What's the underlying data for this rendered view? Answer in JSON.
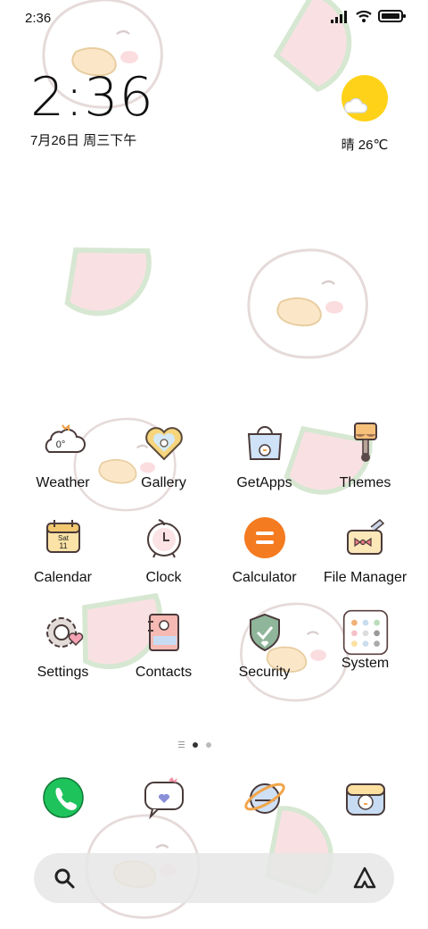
{
  "status_bar": {
    "time": "2:36",
    "icons": [
      "signal-icon",
      "wifi-icon",
      "battery-icon"
    ]
  },
  "clock_widget": {
    "time": "2:36",
    "date": "7月26日 周三下午"
  },
  "weather_widget": {
    "icon": "sun-cloud-icon",
    "text": "晴 26℃"
  },
  "apps": [
    {
      "label": "Weather",
      "icon": "weather-cloud-icon",
      "badge": "0°"
    },
    {
      "label": "Gallery",
      "icon": "heart-frame-icon"
    },
    {
      "label": "GetApps",
      "icon": "shopping-bag-icon"
    },
    {
      "label": "Themes",
      "icon": "paintbrush-icon"
    },
    {
      "label": "Calendar",
      "icon": "calendar-icon",
      "badge_day": "Sat",
      "badge_date": "11"
    },
    {
      "label": "Clock",
      "icon": "alarm-clock-icon"
    },
    {
      "label": "Calculator",
      "icon": "calculator-icon"
    },
    {
      "label": "File Manager",
      "icon": "folder-bow-icon"
    },
    {
      "label": "Settings",
      "icon": "gear-heart-icon"
    },
    {
      "label": "Contacts",
      "icon": "address-book-icon"
    },
    {
      "label": "Security",
      "icon": "shield-check-icon"
    },
    {
      "label": "System",
      "icon": "system-folder-icon"
    }
  ],
  "pager": {
    "pages": 2,
    "active": 1
  },
  "dock": [
    {
      "icon": "phone-icon"
    },
    {
      "icon": "message-heart-icon"
    },
    {
      "icon": "browser-icon"
    },
    {
      "icon": "camera-duck-icon"
    }
  ],
  "search": {
    "icons": [
      "search-icon",
      "assistant-icon"
    ]
  },
  "colors": {
    "sun": "#ffd21a",
    "phone": "#1ec35c",
    "calculator": "#f47b20"
  }
}
